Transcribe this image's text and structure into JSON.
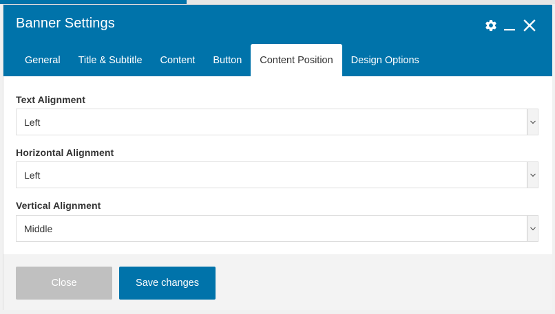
{
  "window": {
    "title": "Banner Settings",
    "icons": {
      "settings": "gear-icon",
      "minimize": "minimize-icon",
      "close": "close-icon"
    }
  },
  "tabs": [
    {
      "label": "General"
    },
    {
      "label": "Title & Subtitle"
    },
    {
      "label": "Content"
    },
    {
      "label": "Button"
    },
    {
      "label": "Content Position",
      "active": true
    },
    {
      "label": "Design Options"
    }
  ],
  "fields": [
    {
      "label": "Text Alignment",
      "value": "Left"
    },
    {
      "label": "Horizontal Alignment",
      "value": "Left"
    },
    {
      "label": "Vertical Alignment",
      "value": "Middle"
    }
  ],
  "footer": {
    "close_label": "Close",
    "save_label": "Save changes"
  },
  "colors": {
    "accent": "#0073aa",
    "disabled_button": "#c0c0c0",
    "footer_bg": "#f3f3f3"
  }
}
